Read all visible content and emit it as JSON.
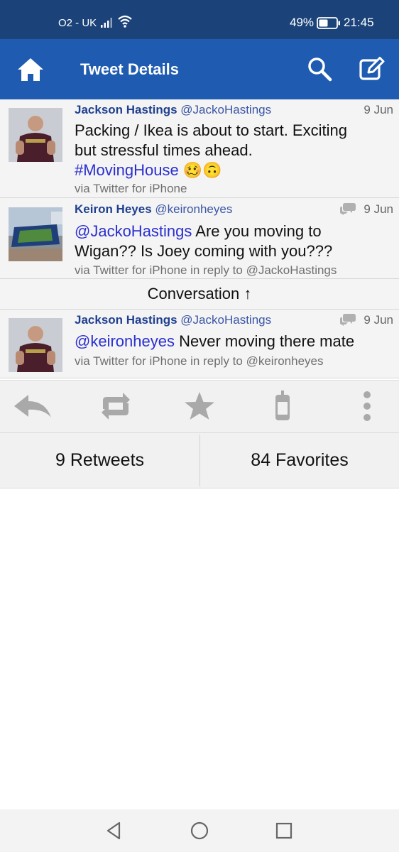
{
  "status_bar": {
    "carrier": "O2 - UK",
    "battery_percent": "49%",
    "time": "21:45",
    "icons": [
      "signal-icon",
      "wifi-icon",
      "battery-icon"
    ]
  },
  "app_bar": {
    "title": "Tweet Details",
    "icons": [
      "home-icon",
      "search-icon",
      "compose-icon"
    ]
  },
  "tweets": [
    {
      "name": "Jackson Hastings",
      "handle": "@JackoHastings",
      "date": "9 Jun",
      "text_line1": "Packing / Ikea is about to start. Exciting",
      "text_line2": "but stressful times ahead.",
      "hashtag": "#MovingHouse",
      "emoji": "🥴🙃",
      "via": "via Twitter for iPhone"
    },
    {
      "name": "Keiron Heyes",
      "handle": "@keironheyes",
      "date": "9 Jun",
      "mention": "@JackoHastings",
      "text_rest": " Are you moving to",
      "text_line2": "Wigan?? Is Joey coming with you???",
      "via": "via Twitter for iPhone in reply to @JackoHastings"
    },
    {
      "name": "Jackson Hastings",
      "handle": "@JackoHastings",
      "date": "9 Jun",
      "mention": "@keironheyes",
      "text_rest": " Never moving there mate",
      "via": "via Twitter for iPhone in reply to @keironheyes"
    }
  ],
  "conversation_label": "Conversation ↑",
  "actions": [
    "reply-icon",
    "retweet-icon",
    "favorite-icon",
    "phone-icon",
    "more-icon"
  ],
  "stats": {
    "retweets": "9 Retweets",
    "favorites": "84 Favorites"
  },
  "nav": [
    "back-icon",
    "home-circle-icon",
    "recents-icon"
  ],
  "colors": {
    "status_bar": "#1b4379",
    "app_bar": "#1f5bb0",
    "name": "#1f3f8f",
    "link": "#2a2fd0"
  }
}
